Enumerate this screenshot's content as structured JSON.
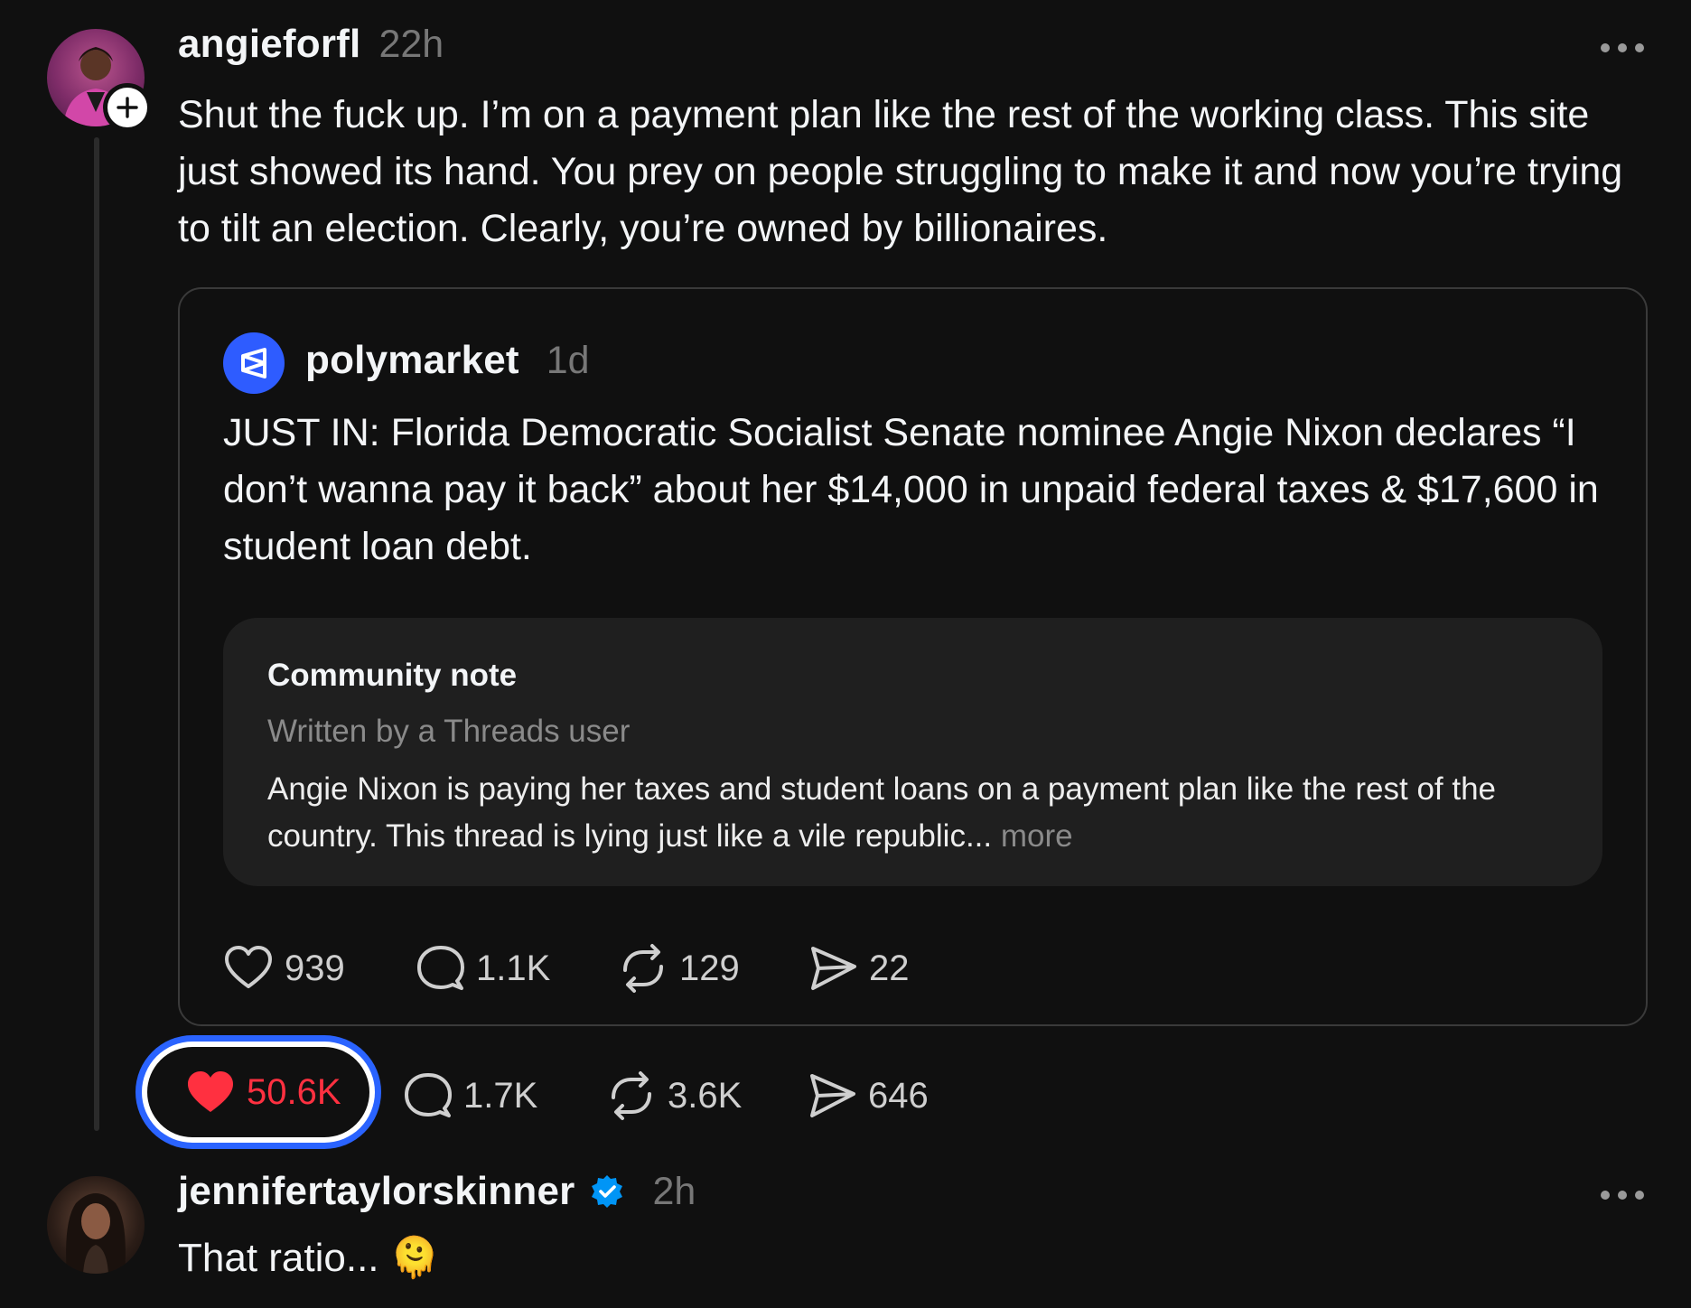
{
  "post": {
    "username": "angieforfl",
    "time": "22h",
    "text": "Shut the fuck up. I’m on a payment plan like the rest of the working class. This site just showed its hand. You prey on people struggling to make it and now you’re trying to tilt an election. Clearly, you’re owned by billionaires.",
    "actions": {
      "likes": "50.6K",
      "replies": "1.7K",
      "reposts": "3.6K",
      "shares": "646"
    }
  },
  "quote": {
    "username": "polymarket",
    "time": "1d",
    "text": "JUST IN: Florida Democratic Socialist Senate nominee Angie Nixon declares “I don’t wanna pay it back” about her $14,000 in unpaid federal taxes & $17,600 in student loan debt.",
    "note": {
      "title": "Community note",
      "subtitle": "Written by a Threads user",
      "body": "Angie Nixon is paying her taxes and student loans on a payment plan like the rest of the country. This thread is lying just like a vile republic...",
      "more": "more"
    },
    "actions": {
      "likes": "939",
      "replies": "1.1K",
      "reposts": "129",
      "shares": "22"
    }
  },
  "reply": {
    "username": "jennifertaylorskinner",
    "time": "2h",
    "text": "That ratio... 🫠"
  },
  "colors": {
    "background": "#101010",
    "like_red": "#ff3040",
    "highlight_blue": "#2a63ff",
    "verified_blue": "#0095f6",
    "polymarket_blue": "#2e5cff"
  },
  "icons": [
    "plus-icon",
    "more-icon",
    "polymarket-logo-icon",
    "heart-icon",
    "comment-icon",
    "repost-icon",
    "share-icon",
    "verified-badge-icon"
  ]
}
